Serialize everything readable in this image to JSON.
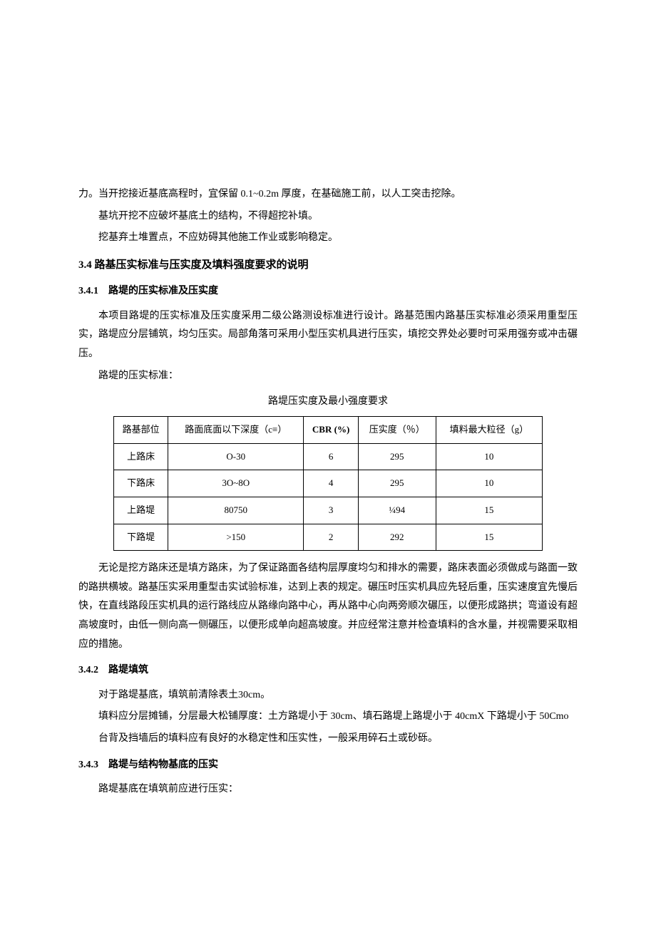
{
  "p1": "力。当开挖接近基底高程时，宜保留 0.1~0.2m 厚度，在基础施工前，以人工突击挖除。",
  "p2": "基坑开挖不应破坏基底土的结构，不得超挖补填。",
  "p3": "挖基弃土堆置点，不应妨碍其他施工作业或影响稳定。",
  "h2_34": "3.4 路基压实标准与压实度及填料强度要求的说明",
  "h3_341": "3.4.1　路堤的压实标准及压实度",
  "p4": "本项目路堤的压实标准及压实度采用二级公路测设标准进行设计。路基范围内路基压实标准必须采用重型压实，路堤应分层铺筑，均匀压实。局部角落可采用小型压实机具进行压实，填挖交界处必要时可采用强夯或冲击碾压。",
  "p5": "路堤的压实标准：",
  "table_caption": "路堤压实度及最小强度要求",
  "table": {
    "headers": [
      "路基部位",
      "路面底面以下深度（c≡）",
      "CBR (%)",
      "压实度（％）",
      "填料最大粒径（g）"
    ],
    "rows": [
      [
        "上路床",
        "O-30",
        "6",
        "295",
        "10"
      ],
      [
        "下路床",
        "3O~8O",
        "4",
        "295",
        "10"
      ],
      [
        "上路堤",
        "80750",
        "3",
        "¼94",
        "15"
      ],
      [
        "下路堤",
        ">150",
        "2",
        "292",
        "15"
      ]
    ]
  },
  "p6": "无论是挖方路床还是填方路床，为了保证路面各结构层厚度均匀和排水的需要，路床表面必须做成与路面一致的路拱横坡。路基压实采用重型击实试验标准，达到上表的规定。碾压时压实机具应先轻后重，压实速度宜先慢后快，在直线路段压实机具的运行路线应从路缘向路中心，再从路中心向两旁顺次碾压，以便形成路拱；弯道设有超高坡度时，由低一侧向高一侧碾压，以便形成单向超高坡度。并应经常注意并检查填料的含水量，并视需要采取相应的措施。",
  "h3_342": "3.4.2　路堤填筑",
  "p7": "对于路堤基底，填筑前清除表土30cm。",
  "p8": "填料应分层摊铺，分层最大松铺厚度：土方路堤小于 30cm、填石路堤上路堤小于 40cmX 下路堤小于 50Cmo",
  "p9": "台背及挡墙后的填料应有良好的水稳定性和压实性，一般采用碎石土或砂砾。",
  "h3_343": "3.4.3　路堤与结构物基底的压实",
  "p10": "路堤基底在填筑前应进行压实："
}
